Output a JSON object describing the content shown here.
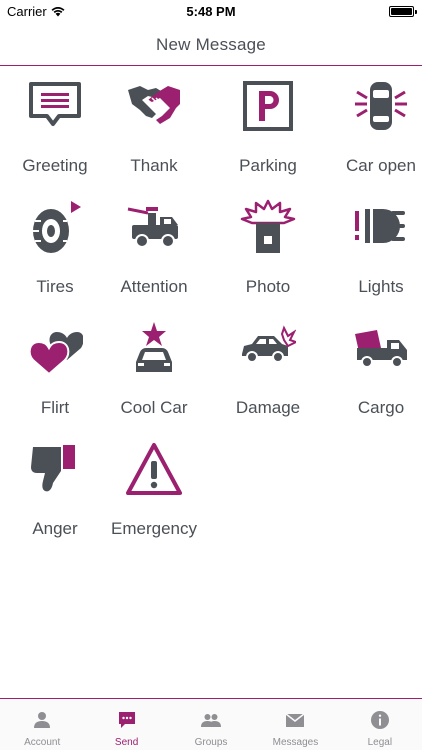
{
  "status_bar": {
    "carrier": "Carrier",
    "time": "5:48 PM"
  },
  "nav": {
    "title": "New Message"
  },
  "colors": {
    "accent": "#9b2070",
    "icon_gray": "#4b5057",
    "tab_inactive": "#8e8e93"
  },
  "messages": [
    {
      "label": "Greeting",
      "icon": "speech-bubble-icon"
    },
    {
      "label": "Thank",
      "icon": "handshake-icon"
    },
    {
      "label": "Parking",
      "icon": "parking-sign-icon"
    },
    {
      "label": "Car open",
      "icon": "car-open-icon"
    },
    {
      "label": "Tires",
      "icon": "tire-icon"
    },
    {
      "label": "Attention",
      "icon": "tow-truck-icon"
    },
    {
      "label": "Photo",
      "icon": "speed-camera-icon"
    },
    {
      "label": "Lights",
      "icon": "headlight-icon"
    },
    {
      "label": "Flirt",
      "icon": "hearts-icon"
    },
    {
      "label": "Cool Car",
      "icon": "star-car-icon"
    },
    {
      "label": "Damage",
      "icon": "car-damage-icon"
    },
    {
      "label": "Cargo",
      "icon": "cargo-truck-icon"
    },
    {
      "label": "Anger",
      "icon": "thumbs-down-icon"
    },
    {
      "label": "Emergency",
      "icon": "warning-triangle-icon"
    }
  ],
  "tabs": [
    {
      "label": "Account",
      "icon": "person-icon",
      "active": false
    },
    {
      "label": "Send",
      "icon": "chat-bubble-icon",
      "active": true
    },
    {
      "label": "Groups",
      "icon": "group-icon",
      "active": false
    },
    {
      "label": "Messages",
      "icon": "envelope-icon",
      "active": false
    },
    {
      "label": "Legal",
      "icon": "info-icon",
      "active": false
    }
  ]
}
